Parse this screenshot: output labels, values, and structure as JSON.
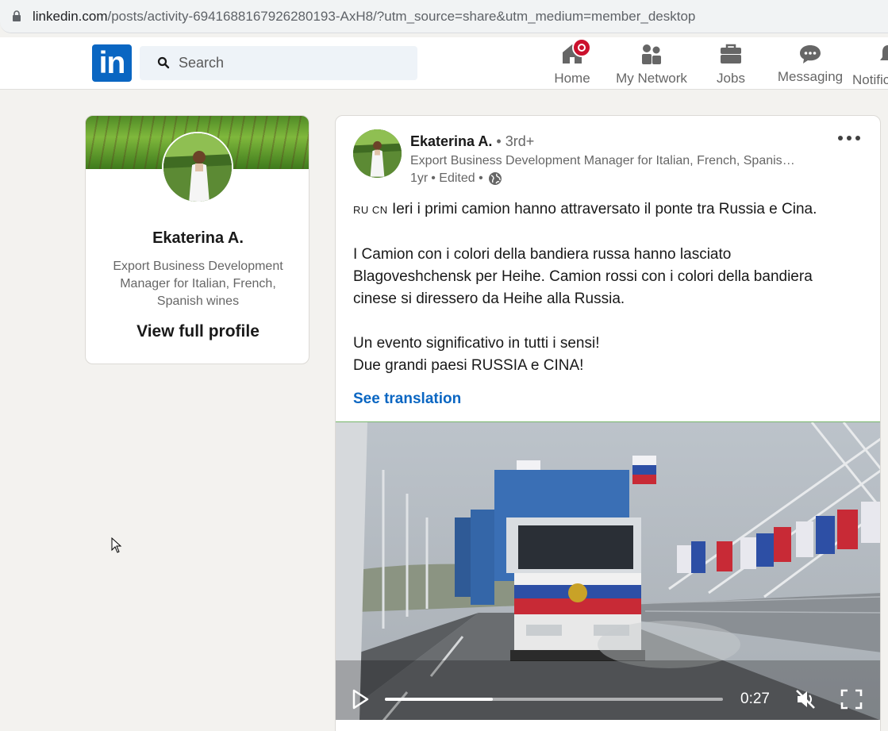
{
  "browser": {
    "url_domain": "linkedin.com",
    "url_path": "/posts/activity-6941688167926280193-AxH8/?utm_source=share&utm_medium=member_desktop"
  },
  "nav": {
    "logo_text": "in",
    "search_placeholder": "Search",
    "items": [
      {
        "label": "Home",
        "icon": "home-icon",
        "badge": true
      },
      {
        "label": "My Network",
        "icon": "network-icon"
      },
      {
        "label": "Jobs",
        "icon": "briefcase-icon"
      },
      {
        "label": "Messaging",
        "icon": "messaging-icon"
      },
      {
        "label": "Notifications",
        "icon": "bell-icon"
      }
    ]
  },
  "profile_card": {
    "name": "Ekaterina A.",
    "headline": "Export Business Development Manager for Italian, French, Spanish wines",
    "view_profile": "View full profile"
  },
  "post": {
    "author": "Ekaterina A.",
    "degree": " • 3rd+",
    "headline": "Export Business Development Manager for Italian, French, Spanish wines",
    "time": "1yr",
    "edited": "• Edited •",
    "flags": "RU CN",
    "body_line1": " Ieri i primi camion hanno attraversato il ponte tra Russia e Cina.",
    "body_para2": [
      "I Camion con i colori della bandiera russa hanno lasciato",
      "Blagoveshchensk per Heihe. Camion rossi con i colori della bandiera",
      "cinese si diressero da Heihe alla Russia."
    ],
    "body_para3": [
      "Un evento significativo in tutti i sensi!",
      "Due grandi paesi RUSSIA e CINA!"
    ],
    "see_translation": "See translation",
    "video": {
      "time": "0:27",
      "progress": 0.32
    }
  },
  "colors": {
    "brand": "#0a66c2",
    "badge": "#cb112d",
    "background": "#f3f2ef"
  }
}
